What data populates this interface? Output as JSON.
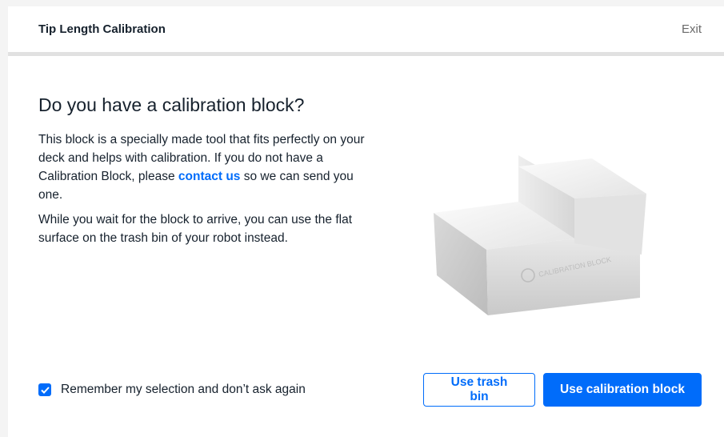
{
  "header": {
    "title": "Tip Length Calibration",
    "exit_label": "Exit"
  },
  "main": {
    "heading": "Do you have a calibration block?",
    "paragraph1_before_link": "This block is a specially made tool that fits perfectly on your deck and helps with calibration. If you do not have a Calibration Block, please ",
    "link_text": "contact us",
    "paragraph1_after_link": " so we can send you one.",
    "paragraph2": "While you wait for the block to arrive,  you can use the flat surface on the trash bin of your robot instead.",
    "block_engraving": "CALIBRATION BLOCK"
  },
  "footer": {
    "checkbox_label": "Remember my selection and don’t ask again",
    "checkbox_checked": true,
    "secondary_button": "Use trash bin",
    "primary_button": "Use calibration block"
  },
  "colors": {
    "accent": "#006cfa",
    "text": "#16212d",
    "muted": "#6a6a6a"
  },
  "icons": {
    "checkbox": "check-icon",
    "illustration": "calibration-block-image"
  }
}
